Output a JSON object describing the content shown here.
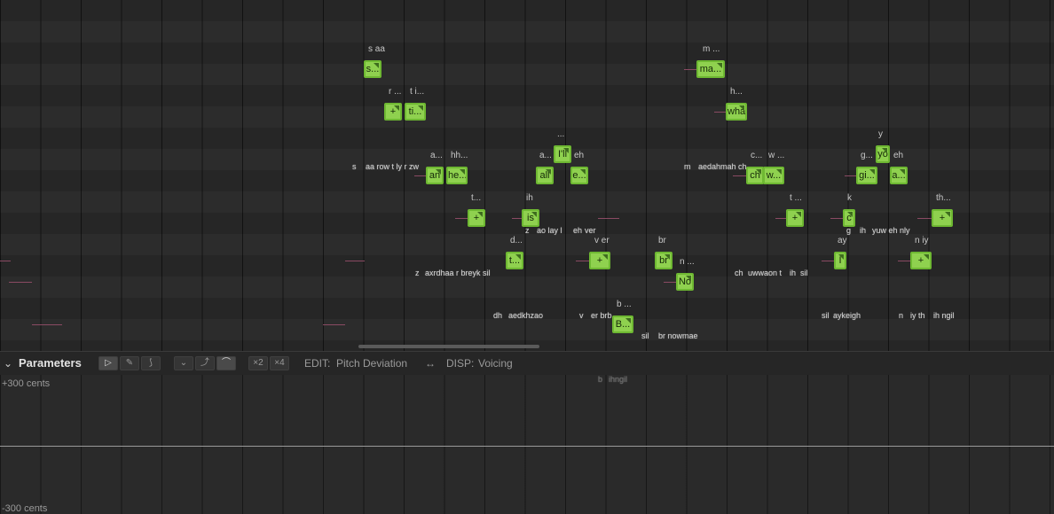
{
  "roll": {
    "notes": [
      {
        "id": "n1",
        "text": "s...",
        "label": "s aa"
      },
      {
        "id": "n2",
        "text": "+",
        "label": "r ..."
      },
      {
        "id": "n3",
        "text": "ti...",
        "label": "t i..."
      },
      {
        "id": "n4",
        "text": "an",
        "label": "a..."
      },
      {
        "id": "n5",
        "text": "he...",
        "label": "hh..."
      },
      {
        "id": "n6",
        "text": "+",
        "label": "t..."
      },
      {
        "id": "n7",
        "text": "t...",
        "label": "d..."
      },
      {
        "id": "n8",
        "text": "is",
        "label": "ih"
      },
      {
        "id": "n9",
        "text": "all",
        "label": "a..."
      },
      {
        "id": "n10",
        "text": "I'll",
        "label": "..."
      },
      {
        "id": "n11",
        "text": "e...",
        "label": "eh"
      },
      {
        "id": "n12",
        "text": "+",
        "label": "v er"
      },
      {
        "id": "n13",
        "text": "B...",
        "label": "b ..."
      },
      {
        "id": "n14",
        "text": "br",
        "label": "br"
      },
      {
        "id": "n15",
        "text": "No",
        "label": "n ..."
      },
      {
        "id": "n16",
        "text": "ma...",
        "label": "m ..."
      },
      {
        "id": "n17",
        "text": "wha",
        "label": "h..."
      },
      {
        "id": "n18",
        "text": "ch",
        "label": "c..."
      },
      {
        "id": "n19",
        "text": "w...",
        "label": "w ..."
      },
      {
        "id": "n20",
        "text": "+",
        "label": "t ..."
      },
      {
        "id": "n21",
        "text": "c",
        "label": "k"
      },
      {
        "id": "n22",
        "text": "I",
        "label": "ay"
      },
      {
        "id": "n23",
        "text": "gi...",
        "label": "g..."
      },
      {
        "id": "n24",
        "text": "yo",
        "label": "y"
      },
      {
        "id": "n25",
        "text": "a...",
        "label": "eh"
      },
      {
        "id": "n26",
        "text": "+",
        "label": "th..."
      },
      {
        "id": "n27",
        "text": "+",
        "label": "n iy"
      }
    ],
    "phonemes": [
      "s",
      "aa row t ly r zw",
      "z",
      "axrdhaa r breyk sil",
      "dh",
      "aedkhzao",
      "z",
      "ao lay l",
      "eh",
      "ver",
      "v",
      "er brb",
      "sil",
      "br nowmae",
      "m",
      "aedahmah ch",
      "ch",
      "uwwaon t",
      "ih",
      "sil",
      "g",
      "ih",
      "yuw eh nly",
      "sil",
      "aykeigh",
      "n",
      "iy th",
      "ih ngil",
      "b",
      "ihngil"
    ]
  },
  "toolbar": {
    "title": "Parameters",
    "tool_buttons": [
      "▷",
      "✎",
      "⟆"
    ],
    "curve_buttons": [
      "⌄",
      "⤴",
      "⌒"
    ],
    "multiplier_buttons": [
      "×2",
      "×4"
    ],
    "edit_label": "EDIT:",
    "edit_value": "Pitch Deviation",
    "swap_icon": "↔",
    "disp_label": "DISP:",
    "disp_value": "Voicing"
  },
  "params": {
    "top_label": "+300 cents",
    "bottom_label": "-300 cents"
  },
  "colors": {
    "note_fill": "#8fd14f",
    "note_border": "#6eb832",
    "pitch_line": "#8a4a63"
  }
}
